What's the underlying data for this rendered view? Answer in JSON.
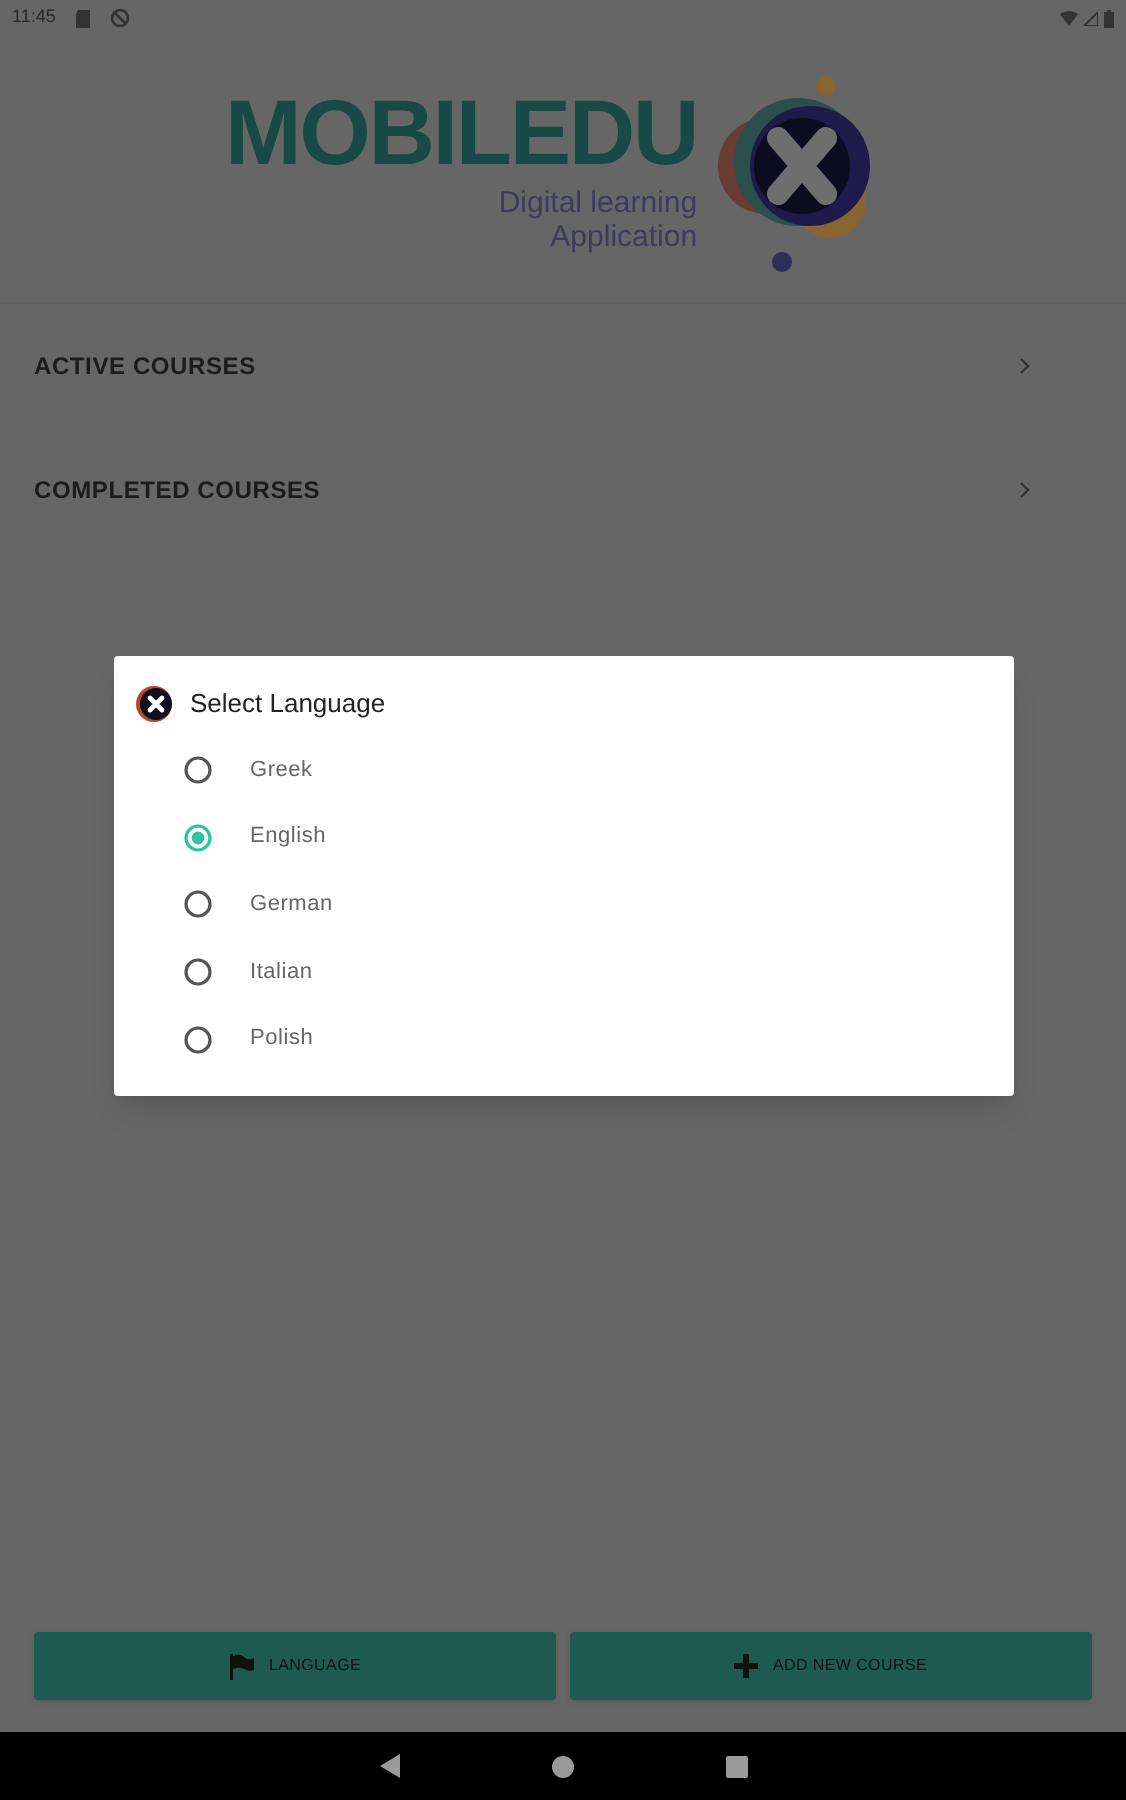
{
  "status_bar": {
    "time": "11:45"
  },
  "logo": {
    "wordmark": "MOBILEDU",
    "tagline_1": "Digital learning",
    "tagline_2": "Application"
  },
  "menu": [
    {
      "label": "ACTIVE COURSES"
    },
    {
      "label": "COMPLETED COURSES"
    }
  ],
  "dialog": {
    "title": "Select Language",
    "options": [
      {
        "label": "Greek",
        "selected": false
      },
      {
        "label": "English",
        "selected": true
      },
      {
        "label": "German",
        "selected": false
      },
      {
        "label": "Italian",
        "selected": false
      },
      {
        "label": "Polish",
        "selected": false
      }
    ]
  },
  "buttons": [
    {
      "kind": "flag",
      "label": "LANGUAGE"
    },
    {
      "kind": "plus",
      "label": "ADD NEW COURSE"
    }
  ]
}
